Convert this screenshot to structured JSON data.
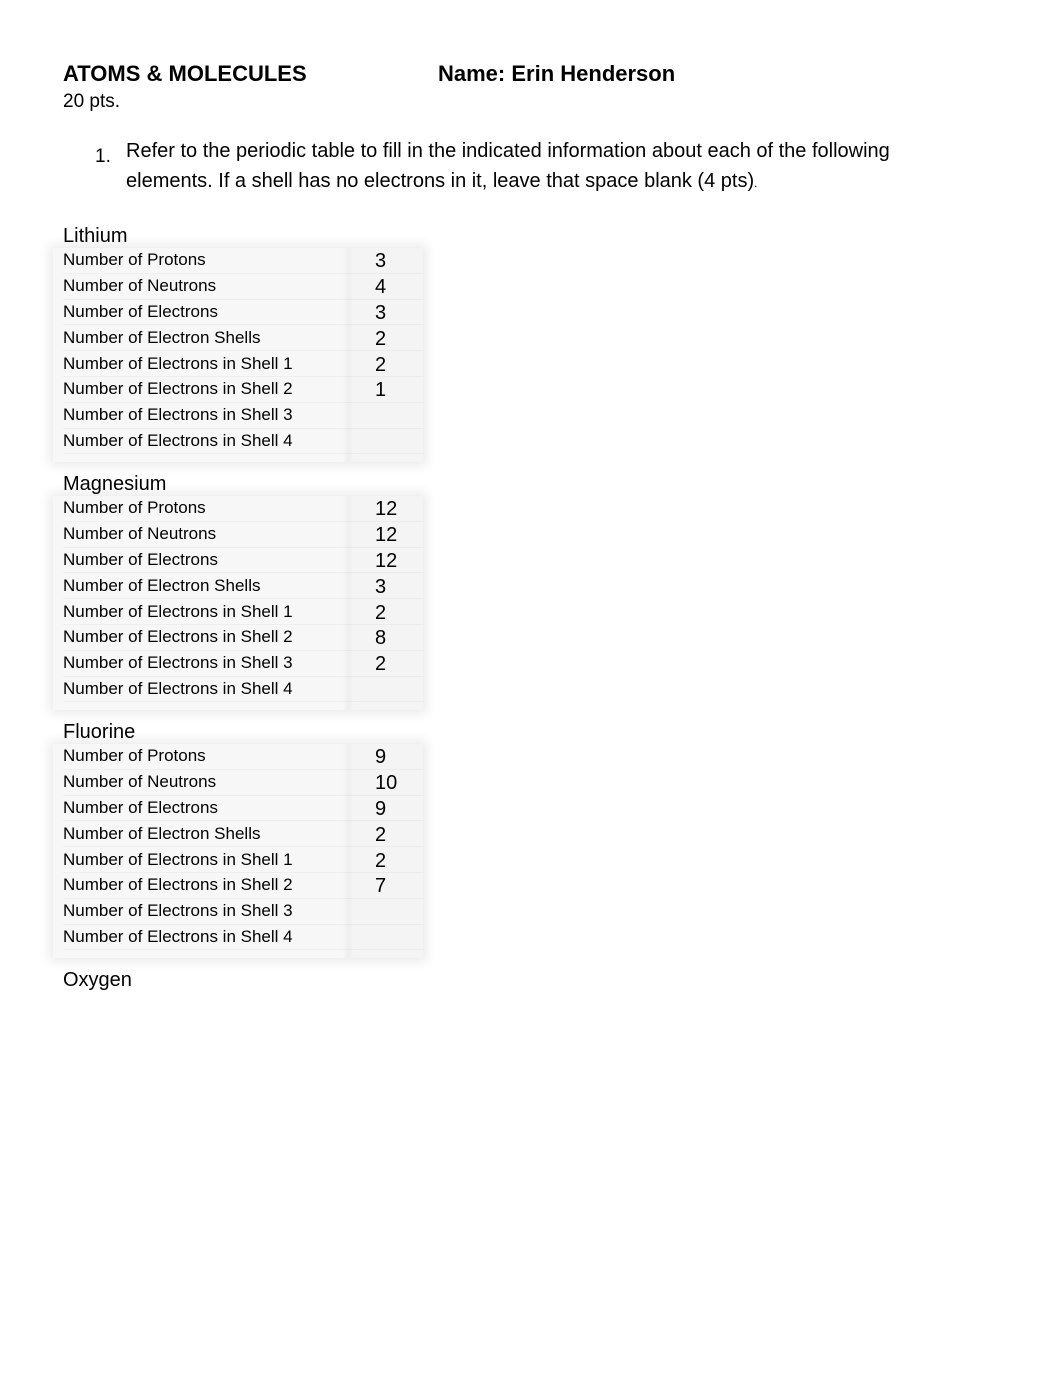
{
  "header": {
    "title": "ATOMS & MOLECULES",
    "name": "Name: Erin Henderson",
    "points": "20 pts."
  },
  "question": {
    "number": "1.",
    "text": "Refer to the periodic table to fill in the indicated information about each of the following elements. If a shell has no electrons in it, leave that space blank (4 pts)",
    "trailing": "."
  },
  "row_labels": [
    "Number of Protons",
    "Number of Neutrons",
    "Number of Electrons",
    "Number of Electron Shells",
    "Number of Electrons in Shell 1",
    "Number of Electrons in Shell 2",
    "Number of Electrons in Shell 3",
    "Number of Electrons in Shell 4"
  ],
  "elements": [
    {
      "name": "Lithium",
      "values": [
        "3",
        "4",
        "3",
        "2",
        "2",
        "1",
        "",
        ""
      ]
    },
    {
      "name": "Magnesium",
      "values": [
        "12",
        "12",
        "12",
        "3",
        "2",
        "8",
        "2",
        ""
      ]
    },
    {
      "name": "Fluorine",
      "values": [
        "9",
        "10",
        "9",
        "2",
        "2",
        "7",
        "",
        ""
      ]
    },
    {
      "name": "Oxygen",
      "values": []
    }
  ]
}
